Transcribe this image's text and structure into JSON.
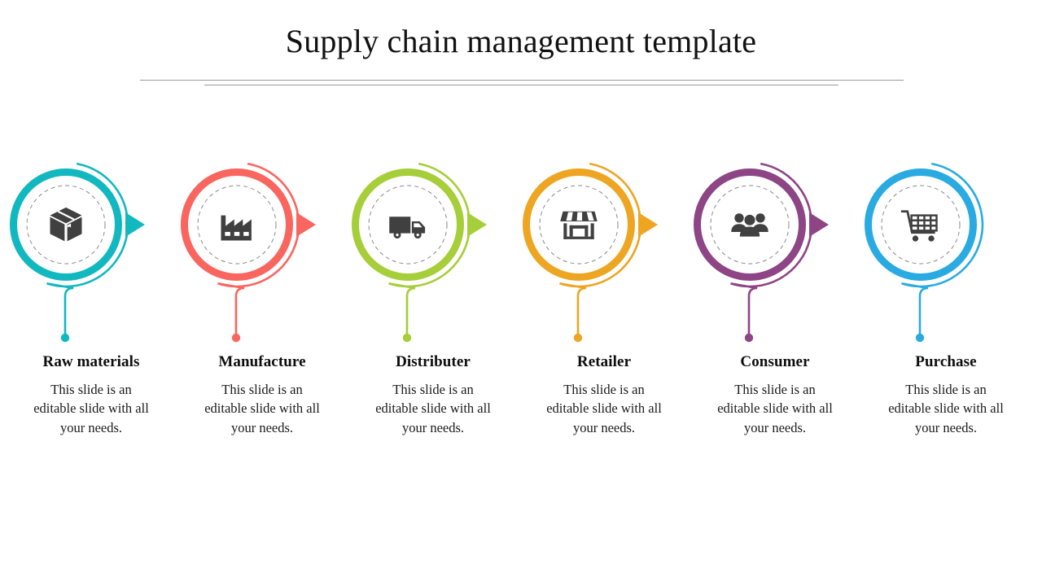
{
  "slide": {
    "title": "Supply chain management template",
    "background_color": "#ffffff",
    "divider_color": "#9a9a9a",
    "icon_color": "#404040"
  },
  "stages": [
    {
      "label": "Raw materials",
      "description": "This slide is an editable slide with all your needs.",
      "color": "#11b8c0",
      "icon": "box-icon",
      "has_arrow": true
    },
    {
      "label": "Manufacture",
      "description": "This slide is an editable slide with all your needs.",
      "color": "#f9655f",
      "icon": "factory-icon",
      "has_arrow": true
    },
    {
      "label": "Distributer",
      "description": "This slide is an editable slide with all your needs.",
      "color": "#a6ce39",
      "icon": "truck-icon",
      "has_arrow": true
    },
    {
      "label": "Retailer",
      "description": "This slide is an editable slide with all your needs.",
      "color": "#eda522",
      "icon": "storefront-icon",
      "has_arrow": true
    },
    {
      "label": "Consumer",
      "description": "This slide is an editable slide with all your needs.",
      "color": "#8e4585",
      "icon": "people-group-icon",
      "has_arrow": true
    },
    {
      "label": "Purchase",
      "description": "This slide is an editable slide with all your needs.",
      "color": "#29abe2",
      "icon": "shopping-cart-icon",
      "has_arrow": false
    }
  ]
}
